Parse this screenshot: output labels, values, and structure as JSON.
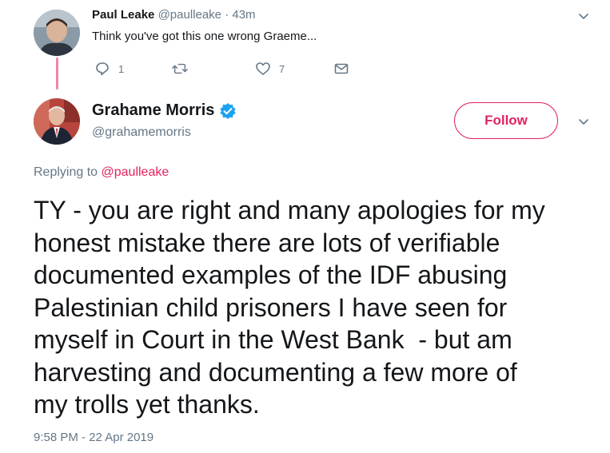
{
  "reply_tweet": {
    "author_name": "Paul Leake",
    "author_handle": "@paulleake",
    "separator": "·",
    "age": "43m",
    "text": "Think you've got this one wrong Graeme...",
    "actions": {
      "reply_count": "1",
      "retweet_count": "",
      "like_count": "7"
    },
    "icons": [
      "reply-icon",
      "retweet-icon",
      "heart-icon",
      "envelope-icon",
      "chevron-down-icon"
    ]
  },
  "main_tweet": {
    "author_name": "Grahame Morris",
    "author_handle": "@grahamemorris",
    "verified": true,
    "follow_label": "Follow",
    "replying_prefix": "Replying to",
    "replying_to": "@paulleake",
    "text": "TY - you are right and many apologies for my\nhonest mistake there are lots of verifiable\ndocumented examples of the IDF abusing\nPalestinian child prisoners I have seen for\nmyself in Court in the West Bank  - but am\nharvesting and documenting a few more of\nmy trolls yet thanks.",
    "timestamp": "9:58 PM - 22 Apr 2019"
  },
  "colors": {
    "accent": "#e0245e",
    "verified": "#1da1f2",
    "secondary_text": "#657786",
    "primary_text": "#14171a"
  }
}
